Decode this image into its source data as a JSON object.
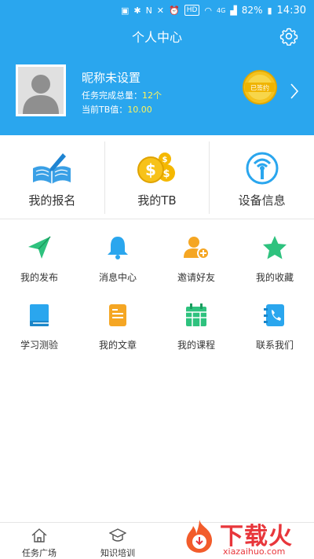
{
  "status_bar": {
    "nfc": "N",
    "hd": "HD",
    "network": "4G",
    "battery": "82%",
    "time": "14:30"
  },
  "header": {
    "title": "个人中心",
    "settings_icon": "gear-icon"
  },
  "profile": {
    "nickname": "昵称未设置",
    "task_label": "任务完成总量：",
    "task_value": "12个",
    "tb_label": "当前TB值：",
    "tb_value": "10.00",
    "badge_text": "已签约"
  },
  "main_items": [
    {
      "label": "我的报名",
      "icon": "book-pen-icon"
    },
    {
      "label": "我的TB",
      "icon": "coins-icon"
    },
    {
      "label": "设备信息",
      "icon": "device-signal-icon"
    }
  ],
  "grid_items": [
    {
      "label": "我的发布",
      "icon": "paper-plane-icon"
    },
    {
      "label": "消息中心",
      "icon": "bell-icon"
    },
    {
      "label": "邀请好友",
      "icon": "add-user-icon"
    },
    {
      "label": "我的收藏",
      "icon": "star-icon"
    },
    {
      "label": "学习测验",
      "icon": "notebook-icon"
    },
    {
      "label": "我的文章",
      "icon": "document-icon"
    },
    {
      "label": "我的课程",
      "icon": "calendar-icon"
    },
    {
      "label": "联系我们",
      "icon": "phone-book-icon"
    }
  ],
  "bottom_nav": [
    {
      "label": "任务广场",
      "icon": "home-icon"
    },
    {
      "label": "知识培训",
      "icon": "graduation-cap-icon"
    }
  ],
  "watermark": {
    "cn": "下载火",
    "en": "xiazaihuo.com"
  },
  "colors": {
    "header_bg": "#2aa6ee",
    "accent_value": "#fff45a",
    "watermark": "#e8363b"
  }
}
